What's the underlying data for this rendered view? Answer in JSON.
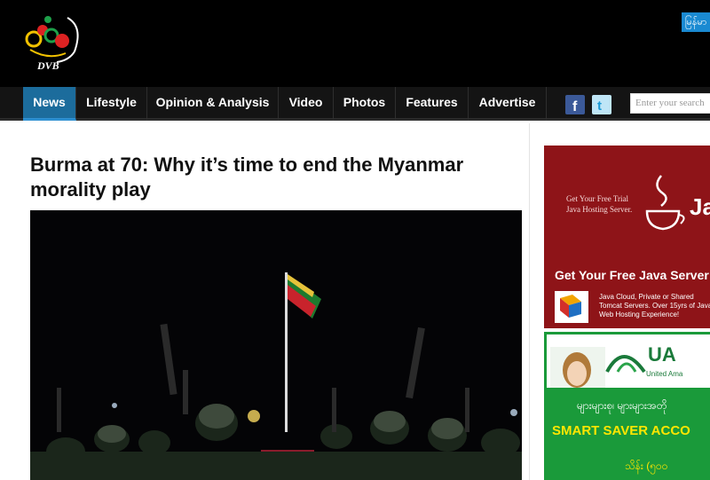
{
  "header": {
    "logo_text": "DVB",
    "language_button": "မြန်မာ"
  },
  "nav": {
    "items": [
      {
        "label": "News",
        "active": true
      },
      {
        "label": "Lifestyle"
      },
      {
        "label": "Opinion & Analysis"
      },
      {
        "label": "Video"
      },
      {
        "label": "Photos"
      },
      {
        "label": "Features"
      },
      {
        "label": "Advertise"
      }
    ],
    "social": [
      {
        "icon": "facebook-icon"
      },
      {
        "icon": "twitter-icon"
      }
    ],
    "search": {
      "placeholder": "Enter your search"
    }
  },
  "article": {
    "title": "Burma at 70: Why it’s time to end the Myanmar morality play"
  },
  "ads": {
    "java": {
      "small_line1": "Get Your Free Trial",
      "small_line2": "Java Hosting Server.",
      "brand": "Ja",
      "headline": "Get Your Free Java Server",
      "body": "Java Cloud, Private or Shared Tomcat Servers. Over 15yrs of Java Web Hosting Experience!"
    },
    "bank": {
      "logo": "UA",
      "sub": "United Ama",
      "myanmar1": "များများစု၊ များများအတို",
      "headline": "SMART SAVER ACCO",
      "myanmar2": "သိန်း (၅၀၀"
    }
  },
  "colors": {
    "header_bg": "#000000",
    "nav_active": "#1c6c9c",
    "ad_java_bg": "#8e1418",
    "ad_bank_green": "#1a9a3a",
    "ad_bank_yellow": "#ffe600"
  }
}
